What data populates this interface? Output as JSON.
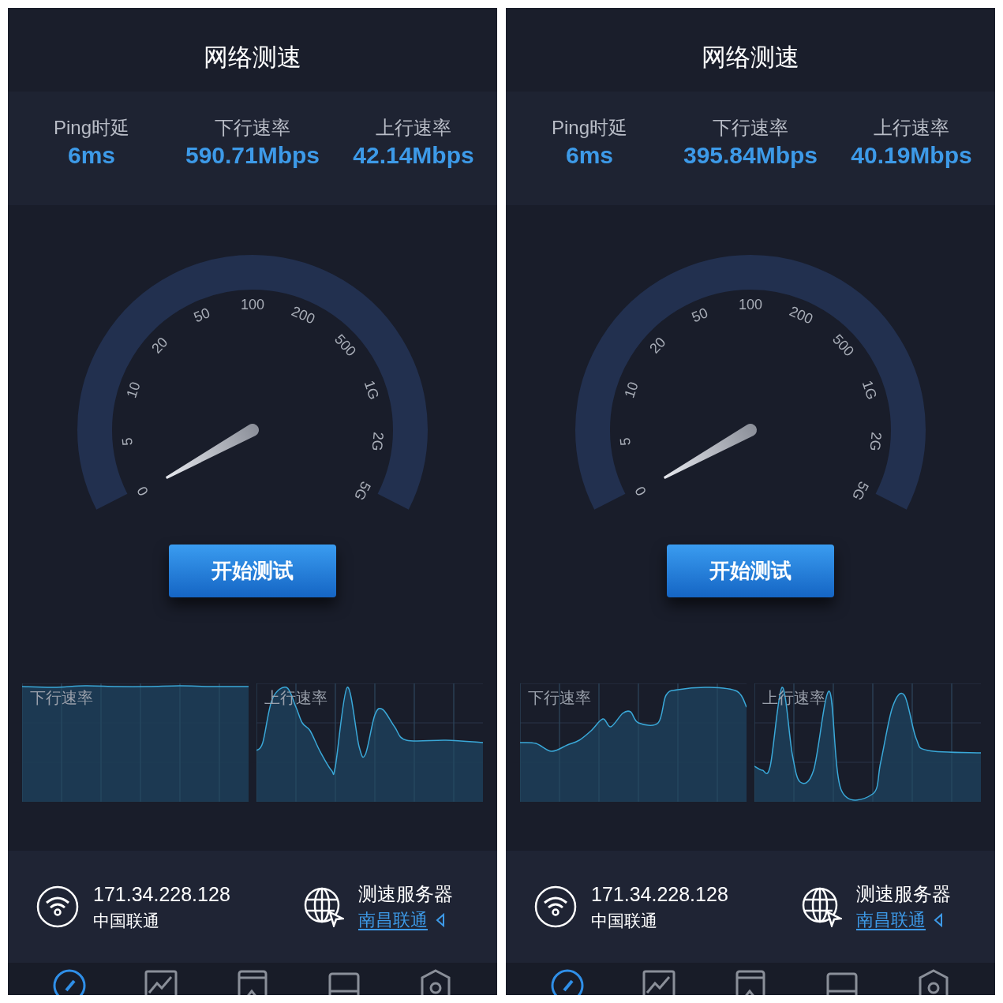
{
  "panels": [
    {
      "title": "网络测速",
      "stats": [
        {
          "label": "Ping时延",
          "value": "6ms"
        },
        {
          "label": "下行速率",
          "value": "590.71Mbps"
        },
        {
          "label": "上行速率",
          "value": "42.14Mbps"
        }
      ],
      "gauge": {
        "scale": [
          "0",
          "5",
          "10",
          "20",
          "50",
          "100",
          "200",
          "500",
          "1G",
          "2G",
          "5G"
        ]
      },
      "start_button": "开始测试",
      "charts": [
        {
          "label": "下行速率"
        },
        {
          "label": "上行速率"
        }
      ],
      "connection": {
        "ip": "171.34.228.128",
        "isp": "中国联通"
      },
      "server": {
        "label": "测速服务器",
        "name": "南昌联通"
      },
      "nav": [
        {
          "selected": true
        },
        {
          "selected": false
        },
        {
          "selected": false
        },
        {
          "selected": false
        },
        {
          "selected": false
        }
      ]
    },
    {
      "title": "网络测速",
      "stats": [
        {
          "label": "Ping时延",
          "value": "6ms"
        },
        {
          "label": "下行速率",
          "value": "395.84Mbps"
        },
        {
          "label": "上行速率",
          "value": "40.19Mbps"
        }
      ],
      "gauge": {
        "scale": [
          "0",
          "5",
          "10",
          "20",
          "50",
          "100",
          "200",
          "500",
          "1G",
          "2G",
          "5G"
        ]
      },
      "start_button": "开始测试",
      "charts": [
        {
          "label": "下行速率"
        },
        {
          "label": "上行速率"
        }
      ],
      "connection": {
        "ip": "171.34.228.128",
        "isp": "中国联通"
      },
      "server": {
        "label": "测速服务器",
        "name": "南昌联通"
      },
      "nav": [
        {
          "selected": true
        },
        {
          "selected": false
        },
        {
          "selected": false
        },
        {
          "selected": false
        },
        {
          "selected": false
        }
      ]
    }
  ]
}
